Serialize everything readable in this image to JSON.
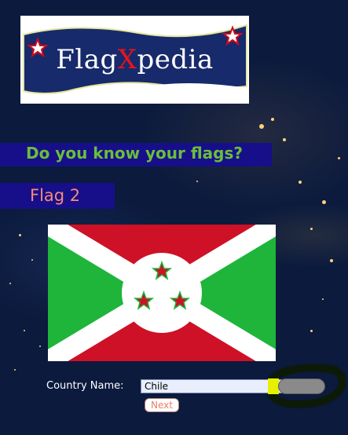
{
  "logo": {
    "text_before": "Flag",
    "text_x": "X",
    "text_after": "pedia"
  },
  "quiz": {
    "question": "Do you know your flags?",
    "flag_label": "Flag 2"
  },
  "flag": {
    "icon": "burundi-flag-icon",
    "colors": {
      "red": "#ce1126",
      "green": "#1eb53a",
      "white": "#ffffff"
    }
  },
  "form": {
    "country_label": "Country Name:",
    "country_value": "Chile",
    "next_label": "Next"
  },
  "colors": {
    "background": "#0b1a3d",
    "banner": "#170f8a",
    "question_text": "#6abf3a",
    "flag_label_text": "#f58a78",
    "highlight": "#e6f000",
    "next_text": "#ea8068"
  }
}
